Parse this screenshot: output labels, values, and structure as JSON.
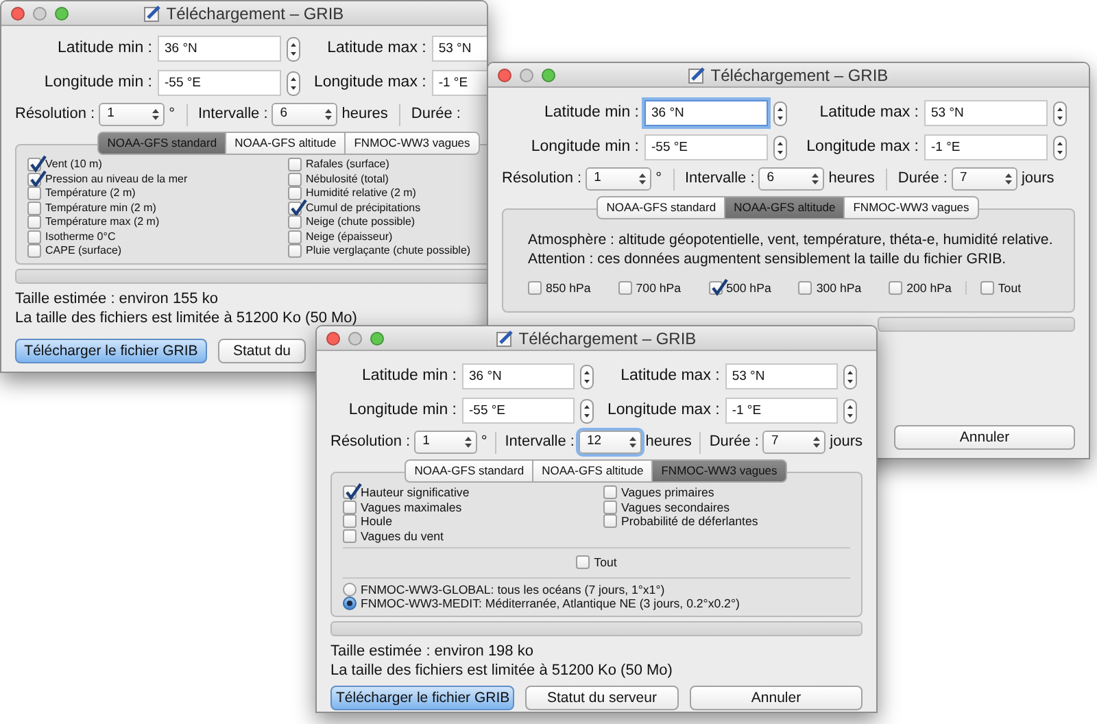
{
  "windows": [
    {
      "title": "Téléchargement – GRIB",
      "coordinates": [
        {
          "label": "Latitude min :",
          "value": "36 °N",
          "focused": false
        },
        {
          "label": "Latitude max :",
          "value": "53 °N",
          "focused": false
        },
        {
          "label": "Longitude min :",
          "value": "-55 °E",
          "focused": false
        },
        {
          "label": "Longitude max :",
          "value": "-1 °E",
          "focused": false
        }
      ],
      "options": [
        {
          "label": "Résolution :",
          "value": "1",
          "unit": "°",
          "focused": false
        },
        {
          "label": "Intervalle :",
          "value": "6",
          "unit": "heures",
          "focused": false
        },
        {
          "label": "Durée :"
        }
      ],
      "tabs": [
        {
          "label": "NOAA-GFS standard",
          "selected": true
        },
        {
          "label": "NOAA-GFS altitude",
          "selected": false
        },
        {
          "label": "FNMOC-WW3 vagues",
          "selected": false
        }
      ],
      "panel": [
        {
          "kind": "columns",
          "columns": [
            [
              {
                "label": "Vent (10 m)",
                "checked": true
              },
              {
                "label": "Pression au niveau de la mer",
                "checked": true
              },
              {
                "label": "Température (2 m)",
                "checked": false
              },
              {
                "label": "Température min (2 m)",
                "checked": false
              },
              {
                "label": "Température max (2 m)",
                "checked": false
              },
              {
                "label": "Isotherme 0°C",
                "checked": false
              },
              {
                "label": "CAPE (surface)",
                "checked": false
              }
            ],
            [
              {
                "label": "Rafales (surface)",
                "checked": false
              },
              {
                "label": "Nébulosité (total)",
                "checked": false
              },
              {
                "label": "Humidité relative (2 m)",
                "checked": false
              },
              {
                "label": "Cumul de précipitations",
                "checked": true
              },
              {
                "label": "Neige (chute possible)",
                "checked": false
              },
              {
                "label": "Neige (épaisseur)",
                "checked": false
              },
              {
                "label": "Pluie verglaçante (chute possible)",
                "checked": false
              }
            ]
          ]
        }
      ],
      "progress": {
        "level": 0
      },
      "notes": [
        "Taille estimée : environ 155 ko",
        "La taille des fichiers est limitée à 51200 Ko (50 Mo)"
      ],
      "buttons": [
        {
          "label": "Télécharger le fichier GRIB",
          "kind": "download"
        },
        {
          "label": "Statut du",
          "kind": "server"
        }
      ]
    },
    {
      "title": "Téléchargement – GRIB",
      "coordinates": [
        {
          "label": "Latitude min :",
          "value": "36 °N",
          "focused": true
        },
        {
          "label": "Latitude max :",
          "value": "53 °N",
          "focused": false
        },
        {
          "label": "Longitude min :",
          "value": "-55 °E",
          "focused": false
        },
        {
          "label": "Longitude max :",
          "value": "-1 °E",
          "focused": false
        }
      ],
      "options": [
        {
          "label": "Résolution :",
          "value": "1",
          "unit": "°",
          "focused": false
        },
        {
          "label": "Intervalle :",
          "value": "6",
          "unit": "heures",
          "focused": false
        },
        {
          "label": "Durée :",
          "value": "7",
          "unit": "jours",
          "focused": false
        }
      ],
      "tabs": [
        {
          "label": "NOAA-GFS standard",
          "selected": false
        },
        {
          "label": "NOAA-GFS altitude",
          "selected": true
        },
        {
          "label": "FNMOC-WW3 vagues",
          "selected": false
        }
      ],
      "panel": [
        {
          "kind": "text",
          "lines": [
            "Atmosphère : altitude géopotentielle, vent, température, théta-e, humidité relative.",
            "Attention : ces données augmentent sensiblement la taille du fichier GRIB."
          ]
        },
        {
          "kind": "row",
          "items": [
            {
              "label": "850 hPa",
              "checked": false
            },
            {
              "label": "700 hPa",
              "checked": false
            },
            {
              "label": "500 hPa",
              "checked": true
            },
            {
              "label": "300 hPa",
              "checked": false
            },
            {
              "label": "200 hPa",
              "checked": false
            }
          ],
          "extra": [
            {
              "label": "Tout",
              "checked": false
            }
          ]
        }
      ],
      "progress": {
        "level": 0
      },
      "buttons": [
        {
          "label": "Annuler",
          "kind": "cancel"
        }
      ]
    },
    {
      "title": "Téléchargement – GRIB",
      "coordinates": [
        {
          "label": "Latitude min :",
          "value": "36 °N",
          "focused": false
        },
        {
          "label": "Latitude max :",
          "value": "53 °N",
          "focused": false
        },
        {
          "label": "Longitude min :",
          "value": "-55 °E",
          "focused": false
        },
        {
          "label": "Longitude max :",
          "value": "-1 °E",
          "focused": false
        }
      ],
      "options": [
        {
          "label": "Résolution :",
          "value": "1",
          "unit": "°",
          "focused": false
        },
        {
          "label": "Intervalle :",
          "value": "12",
          "unit": "heures",
          "focused": true
        },
        {
          "label": "Durée :",
          "value": "7",
          "unit": "jours",
          "focused": false
        }
      ],
      "tabs": [
        {
          "label": "NOAA-GFS standard",
          "selected": false
        },
        {
          "label": "NOAA-GFS altitude",
          "selected": false
        },
        {
          "label": "FNMOC-WW3 vagues",
          "selected": true
        }
      ],
      "panel": [
        {
          "kind": "columns",
          "columns": [
            [
              {
                "label": "Hauteur significative",
                "checked": true
              },
              {
                "label": "Vagues maximales",
                "checked": false
              },
              {
                "label": "Houle",
                "checked": false
              },
              {
                "label": "Vagues du vent",
                "checked": false
              }
            ],
            [
              {
                "label": "Vagues primaires",
                "checked": false
              },
              {
                "label": "Vagues secondaires",
                "checked": false
              },
              {
                "label": "Probabilité de déferlantes",
                "checked": false
              }
            ]
          ]
        },
        {
          "kind": "rule"
        },
        {
          "kind": "center",
          "items": [
            {
              "label": "Tout",
              "checked": false
            }
          ]
        },
        {
          "kind": "rule"
        },
        {
          "kind": "radios",
          "options": [
            {
              "label": "FNMOC-WW3-GLOBAL: tous les océans (7 jours, 1°x1°)",
              "selected": false
            },
            {
              "label": "FNMOC-WW3-MEDIT: Méditerranée, Atlantique NE (3 jours, 0.2°x0.2°)",
              "selected": true
            }
          ]
        }
      ],
      "progress": {
        "level": 0
      },
      "notes": [
        "Taille estimée : environ 198 ko",
        "La taille des fichiers est limitée à 51200 Ko (50 Mo)"
      ],
      "buttons": [
        {
          "label": "Télécharger le fichier GRIB",
          "kind": "download"
        },
        {
          "label": "Statut du serveur",
          "kind": "server"
        },
        {
          "label": "Annuler",
          "kind": "cancel"
        }
      ]
    }
  ]
}
